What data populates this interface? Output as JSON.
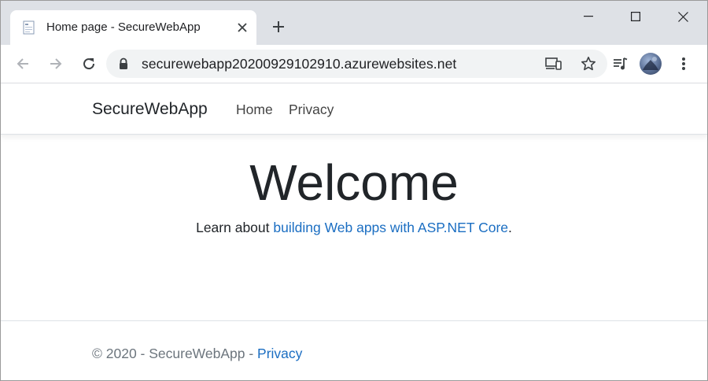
{
  "browser": {
    "tab": {
      "title": "Home page - SecureWebApp",
      "favicon": "page-favicon-icon",
      "close_icon": "close-icon"
    },
    "new_tab_icon": "plus-icon",
    "window_controls": [
      "minimize-icon",
      "maximize-icon",
      "close-icon"
    ],
    "toolbar": {
      "back_icon": "back-arrow-icon",
      "forward_icon": "forward-arrow-icon",
      "reload_icon": "reload-icon",
      "lock_icon": "lock-icon",
      "url": "securewebapp20200929102910.azurewebsites.net",
      "cast_icon": "cast-icon",
      "bookmark_icon": "star-icon",
      "media_icon": "media-playlist-icon",
      "avatar": "profile-avatar",
      "menu_icon": "kebab-menu-icon"
    }
  },
  "site": {
    "brand": "SecureWebApp",
    "nav": [
      {
        "label": "Home"
      },
      {
        "label": "Privacy"
      }
    ],
    "main": {
      "heading": "Welcome",
      "learn_prefix": "Learn about ",
      "learn_link": "building Web apps with ASP.NET Core",
      "learn_suffix": "."
    },
    "footer": {
      "text": "© 2020 - SecureWebApp - ",
      "link": "Privacy"
    }
  },
  "colors": {
    "tabstrip_bg": "#dee1e6",
    "omnibox_bg": "#f1f3f4",
    "link": "#1b6ec2",
    "text": "#212529",
    "muted": "#6c757d"
  }
}
